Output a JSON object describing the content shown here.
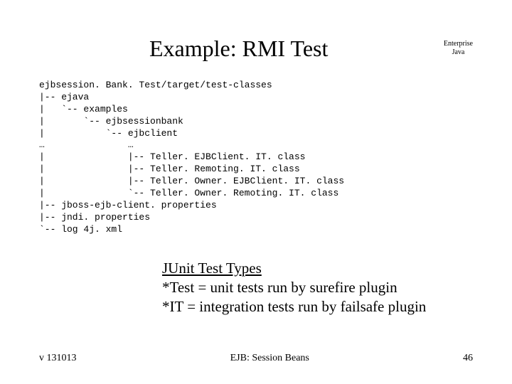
{
  "header": {
    "title": "Example: RMI Test",
    "corner_line1": "Enterprise",
    "corner_line2": "Java"
  },
  "tree": "ejbsession. Bank. Test/target/test-classes\n|-- ejava\n|   `-- examples\n|       `-- ejbsessionbank\n|           `-- ejbclient\n…               …\n|               |-- Teller. EJBClient. IT. class\n|               |-- Teller. Remoting. IT. class\n|               |-- Teller. Owner. EJBClient. IT. class\n|               `-- Teller. Owner. Remoting. IT. class\n|-- jboss-ejb-client. properties\n|-- jndi. properties\n`-- log 4j. xml",
  "notes": {
    "heading": "JUnit Test Types",
    "line1": "*Test = unit tests run by surefire plugin",
    "line2": "*IT = integration tests run by failsafe plugin"
  },
  "footer": {
    "left": "v 131013",
    "center": "EJB: Session Beans",
    "right": "46"
  }
}
